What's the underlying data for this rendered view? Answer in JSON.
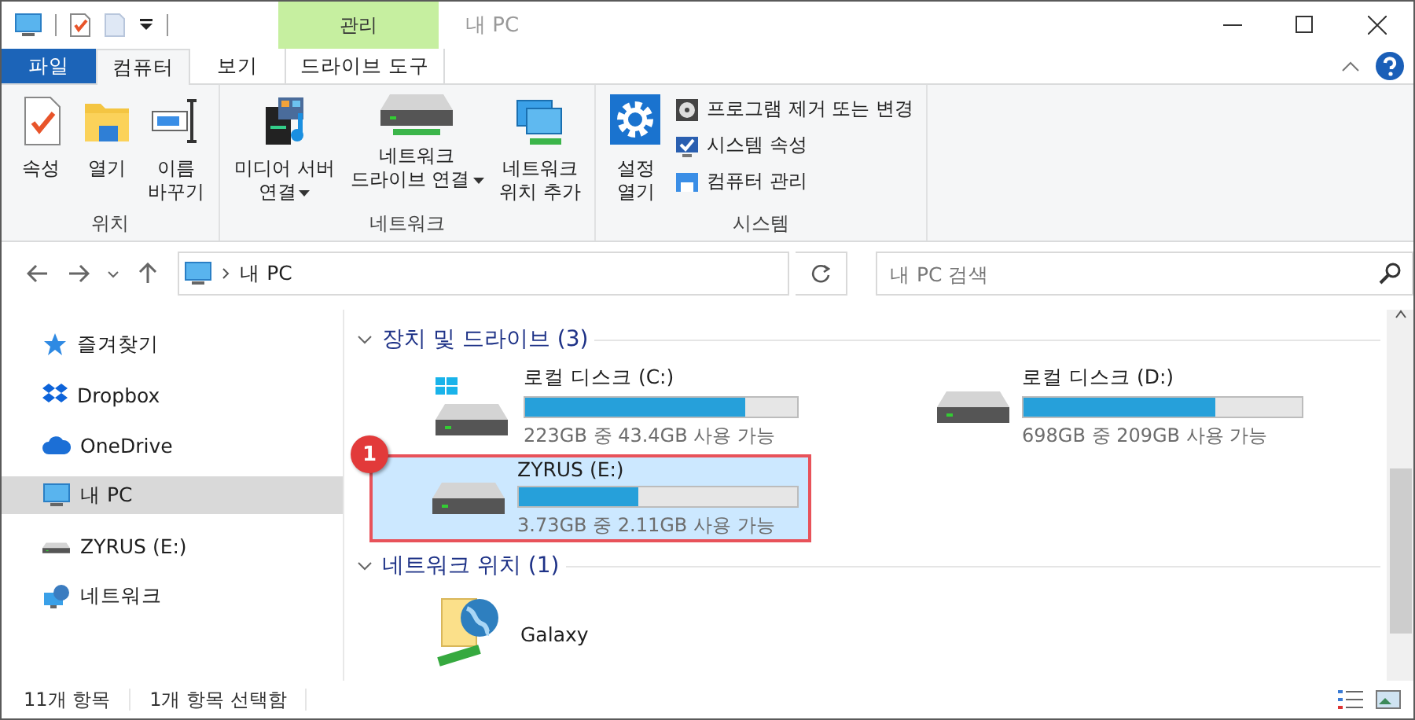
{
  "window": {
    "title": "내 PC",
    "context_tab": "관리"
  },
  "ribbon_tabs": [
    {
      "label": "파일",
      "kind": "file",
      "selected": false
    },
    {
      "label": "컴퓨터",
      "kind": "tab",
      "selected": true
    },
    {
      "label": "보기",
      "kind": "tab",
      "selected": false
    },
    {
      "label": "드라이브 도구",
      "kind": "context",
      "selected": false
    }
  ],
  "ribbon_groups": [
    {
      "label": "위치",
      "buttons": [
        {
          "label": "속성",
          "kind": "properties",
          "dropdown": false
        },
        {
          "label": "열기",
          "kind": "folder",
          "dropdown": false
        },
        {
          "label": "이름\n바꾸기",
          "kind": "rename",
          "dropdown": false
        }
      ]
    },
    {
      "label": "네트워크",
      "buttons": [
        {
          "label": "미디어 서버\n연결",
          "kind": "media",
          "dropdown": true
        },
        {
          "label": "네트워크\n드라이브 연결",
          "kind": "netdrive",
          "dropdown": true
        },
        {
          "label": "네트워크\n위치 추가",
          "kind": "netlocation",
          "dropdown": false
        }
      ]
    },
    {
      "label": "시스템",
      "buttons": [
        {
          "label": "설정\n열기",
          "kind": "settings",
          "dropdown": false
        }
      ],
      "links": [
        {
          "label": "프로그램 제거 또는 변경",
          "kind": "programs"
        },
        {
          "label": "시스템 속성",
          "kind": "sysprops"
        },
        {
          "label": "컴퓨터 관리",
          "kind": "manage"
        }
      ]
    }
  ],
  "address": {
    "path": "내 PC"
  },
  "search": {
    "placeholder": "내 PC 검색"
  },
  "sidebar": {
    "items": [
      {
        "label": "즐겨찾기",
        "kind": "star",
        "selected": false
      },
      {
        "label": "Dropbox",
        "kind": "dropbox",
        "selected": false
      },
      {
        "label": "OneDrive",
        "kind": "cloud",
        "selected": false
      },
      {
        "label": "내 PC",
        "kind": "pc",
        "selected": true
      },
      {
        "label": "ZYRUS (E:)",
        "kind": "drive",
        "selected": false
      },
      {
        "label": "네트워크",
        "kind": "network",
        "selected": false
      }
    ]
  },
  "sections": [
    {
      "title": "장치 및 드라이브 (3)",
      "expanded": true,
      "items": [
        {
          "kind": "system-drive",
          "name": "로컬 디스크 (C:)",
          "level": 0.81,
          "space": "223GB 중 43.4GB 사용 가능",
          "selected": false
        },
        {
          "kind": "drive",
          "name": "로컬 디스크 (D:)",
          "level": 0.69,
          "space": "698GB 중 209GB 사용 가능",
          "selected": false
        },
        {
          "kind": "drive",
          "name": "ZYRUS (E:)",
          "level": 0.43,
          "space": "3.73GB 중 2.11GB 사용 가능",
          "selected": true,
          "callout": "1"
        }
      ]
    },
    {
      "title": "네트워크 위치 (1)",
      "expanded": true,
      "items": [
        {
          "kind": "network-location",
          "name": "Galaxy",
          "selected": false
        }
      ]
    }
  ],
  "status_bar": [
    "11개 항목",
    "1개 항목 선택함"
  ]
}
